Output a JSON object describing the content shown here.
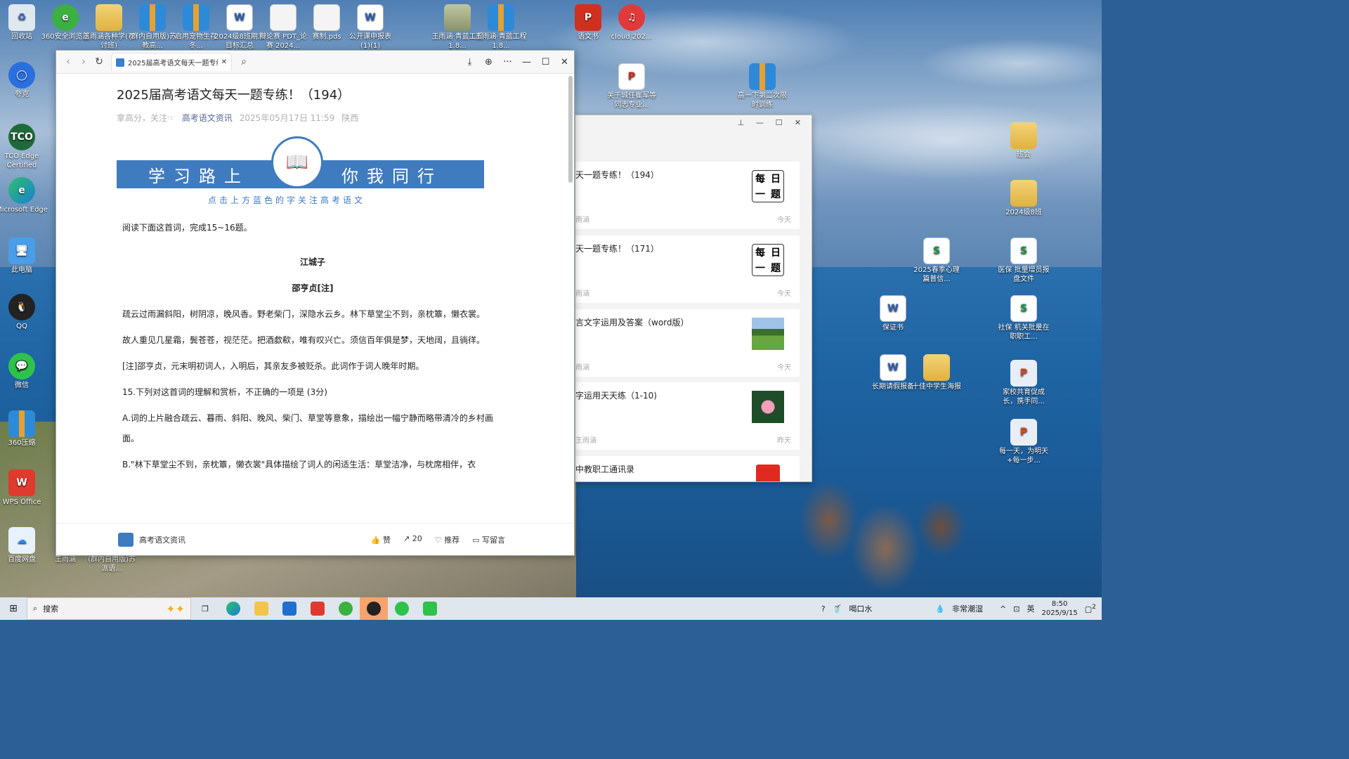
{
  "desktop": {
    "icons_left": [
      {
        "label": "回收站",
        "kind": "bin"
      },
      {
        "label": "360安全浏览器",
        "kind": "ie"
      },
      {
        "label": "王雨涵各种学(不讨班)",
        "kind": "folder"
      },
      {
        "label": "(群内自用版)苏教高...",
        "kind": "zip"
      },
      {
        "label": "启用宠物生存冬...",
        "kind": "zip"
      },
      {
        "label": "2024级8班期末目标汇总",
        "kind": "word"
      },
      {
        "label": "辩论赛 PDT_论赛 2024...",
        "kind": "doc"
      },
      {
        "label": "赛制.pds",
        "kind": "doc"
      },
      {
        "label": "公开课申报表(1)(1)",
        "kind": "word"
      },
      {
        "label": "王雨涵·青蓝工程1.8...",
        "kind": "folder"
      },
      {
        "label": "王雨涵·青蓝工程1.8...",
        "kind": "zip"
      },
      {
        "label": "语文书",
        "kind": "ppt"
      },
      {
        "label": "cloud 202...",
        "kind": "cloud"
      }
    ],
    "icons_column": [
      {
        "label": "夸克",
        "kind": "quark"
      },
      {
        "label": "TCO Edge Certified",
        "kind": "tco"
      },
      {
        "label": "Microsoft Edge",
        "kind": "edge"
      },
      {
        "label": "此电脑",
        "kind": "pc"
      },
      {
        "label": "QQ",
        "kind": "qq"
      },
      {
        "label": "微信",
        "kind": "wechat"
      },
      {
        "label": "360压缩",
        "kind": "zip"
      },
      {
        "label": "WPS Office",
        "kind": "wps"
      },
      {
        "label": "百度网盘",
        "kind": "baidu"
      }
    ],
    "icons_right": [
      {
        "label": "关于城任崔军等同志专业...",
        "kind": "pdf"
      },
      {
        "label": "高一下第二次限时训练",
        "kind": "zip"
      },
      {
        "label": "班会",
        "kind": "folder"
      },
      {
        "label": "2024级8班",
        "kind": "folder"
      },
      {
        "label": "2025春季心理篇普信...",
        "kind": "sheet"
      },
      {
        "label": "医保 批量增员报盘文件",
        "kind": "sheet"
      },
      {
        "label": "保证书",
        "kind": "word"
      },
      {
        "label": "社保 机关批量在职职工...",
        "kind": "sheet"
      },
      {
        "label": "长期请假报备",
        "kind": "word"
      },
      {
        "label": "十佳中学生海报",
        "kind": "folder"
      },
      {
        "label": "家校共育促成长，携手同...",
        "kind": "ppt"
      },
      {
        "label": "每一天，为明天+每一步...",
        "kind": "ppt"
      }
    ],
    "bottom_labels": [
      "王雨涵",
      "(群内自用版)苏派语..."
    ]
  },
  "browser": {
    "tab_title": "2025届高考语文每天一题专练",
    "article": {
      "title": "2025届高考语文每天一题专练！（194）",
      "author": "拿高分，关注☞",
      "source": "高考语文资讯",
      "datetime": "2025年05月17日 11:59",
      "location": "陕西",
      "banner_left": "学习路上",
      "banner_right": "你我同行",
      "banner_sub": "点击上方蓝色的字关注高考语文",
      "intro": "阅读下面这首词，完成15~16题。",
      "poem_title": "江城子",
      "poem_author": "邵亨贞[注]",
      "stanza1": "疏云过雨漏斜阳，树阴凉，晚风香。野老柴门，深隐水云乡。林下草堂尘不到，亲枕簟，懒衣裳。",
      "stanza2": "故人重见几星霜，鬓苍苍，视茫茫。把酒歔欷，唯有叹兴亡。须信百年俱是梦，天地阔，且徜徉。",
      "note": "[注]邵亨贞，元末明初词人，入明后，其亲友多被贬杀。此词作于词人晚年时期。",
      "q15": "15.下列对这首词的理解和赏析，不正确的一项是 (3分)",
      "optA": "A.词的上片融合疏云、暮雨、斜阳、晚风、柴门、草堂等意象，描绘出一幅宁静而略带清冷的乡村画面。",
      "optB": "B.\"林下草堂尘不到，亲枕簟，懒衣裳\"具体描绘了词人的闲适生活：草堂洁净，与枕席相伴，衣"
    },
    "footer": {
      "account": "高考语文资讯",
      "like": "赞",
      "share": "20",
      "recommend": "推荐",
      "comment": "写留言"
    }
  },
  "panel": {
    "cards": [
      {
        "title": "天一题专练！（194）",
        "author": "雨涵",
        "date": "今天",
        "thumb": [
          "每",
          "日",
          "一",
          "题"
        ]
      },
      {
        "title": "天一题专练！（171）",
        "author": "雨涵",
        "date": "今天",
        "thumb": [
          "每",
          "日",
          "一",
          "题"
        ]
      },
      {
        "title": "言文字运用及答案（word版）",
        "author": "雨涵",
        "date": "今天",
        "photo": "field"
      },
      {
        "title": "字运用天天练（1-10)",
        "author": "王雨涵",
        "date": "昨天",
        "photo": "flower"
      },
      {
        "title": "中教职工通讯录",
        "author": "",
        "date": "",
        "photo": "pdf"
      }
    ]
  },
  "taskbar": {
    "search_label": "搜索",
    "weather": "喝口水",
    "humidity": "非常潮湿",
    "ime": "英",
    "time": "8:50",
    "date": "2025/9/15",
    "notif": "2"
  }
}
